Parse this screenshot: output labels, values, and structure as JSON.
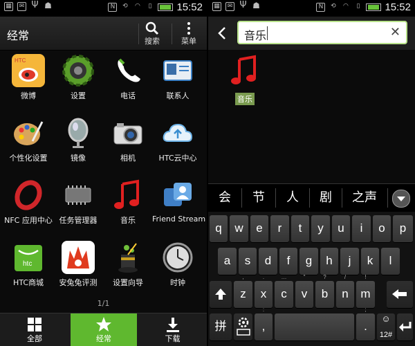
{
  "status": {
    "time_left": "15:52",
    "time_right": "15:52"
  },
  "left": {
    "title": "经常",
    "search_label": "搜索",
    "menu_label": "菜单",
    "apps": [
      {
        "name": "微博",
        "icon": "weibo-icon",
        "color": "#f5a623"
      },
      {
        "name": "设置",
        "icon": "settings-gear-icon",
        "color": "#6aa832"
      },
      {
        "name": "电话",
        "icon": "phone-icon",
        "color": "#5fb82f"
      },
      {
        "name": "联系人",
        "icon": "contacts-card-icon",
        "color": "#3a7fc4"
      },
      {
        "name": "个性化设置",
        "icon": "paint-palette-icon",
        "color": "#d9a55b"
      },
      {
        "name": "镜像",
        "icon": "mirror-icon",
        "color": "#888"
      },
      {
        "name": "相机",
        "icon": "camera-icon",
        "color": "#ccc"
      },
      {
        "name": "HTC云中心",
        "icon": "cloud-icon",
        "color": "#6db3e8"
      },
      {
        "name": "NFC 应用中心",
        "icon": "nfc-ring-icon",
        "color": "#d0262a"
      },
      {
        "name": "任务管理器",
        "icon": "chip-icon",
        "color": "#777"
      },
      {
        "name": "音乐",
        "icon": "music-note-icon",
        "color": "#e02020"
      },
      {
        "name": "Friend Stream",
        "icon": "friend-stream-icon",
        "color": "#4a90d9"
      },
      {
        "name": "HTC商城",
        "icon": "htc-store-bag-icon",
        "color": "#5fb82f"
      },
      {
        "name": "安兔兔评测",
        "icon": "antutu-icon",
        "color": "#e03a1e"
      },
      {
        "name": "设置向导",
        "icon": "wizard-hat-icon",
        "color": "#4c7a1e"
      },
      {
        "name": "时钟",
        "icon": "clock-icon",
        "color": "#666"
      }
    ],
    "pager": "1/1",
    "tabs": [
      {
        "label": "全部",
        "icon": "grid-icon"
      },
      {
        "label": "经常",
        "icon": "star-icon"
      },
      {
        "label": "下载",
        "icon": "download-icon"
      }
    ]
  },
  "right": {
    "search_value": "音乐",
    "result": {
      "name": "音乐",
      "icon": "music-note-icon"
    },
    "candidates": [
      "会",
      "节",
      "人",
      "剧",
      "之声"
    ],
    "rows": [
      [
        "q",
        "w",
        "e",
        "r",
        "t",
        "y",
        "u",
        "i",
        "o",
        "p"
      ],
      [
        "a",
        "s",
        "d",
        "f",
        "g",
        "h",
        "j",
        "k",
        "l"
      ],
      [
        "z",
        "x",
        "c",
        "v",
        "b",
        "n",
        "m"
      ]
    ],
    "pinyin_key": "拼",
    "sym_key": "12#",
    "row3_subs": [
      ",",
      ".",
      "…",
      "\"",
      "?",
      "/",
      "!"
    ]
  },
  "colors": {
    "accent": "#5fb82f",
    "search_border": "#b8e28a"
  }
}
